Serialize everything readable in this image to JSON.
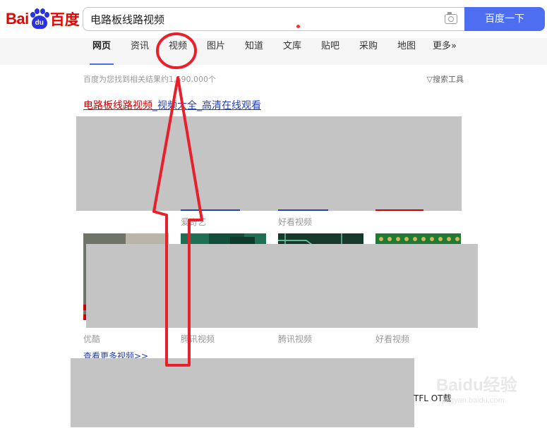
{
  "logo": {
    "bai": "Bai",
    "du": "du",
    "cn": "百度"
  },
  "search": {
    "query": "电路板线路视频",
    "button_label": "百度一下"
  },
  "tabs": [
    {
      "label": "网页",
      "active": true
    },
    {
      "label": "资讯"
    },
    {
      "label": "视频"
    },
    {
      "label": "图片"
    },
    {
      "label": "知道"
    },
    {
      "label": "文库"
    },
    {
      "label": "贴吧"
    },
    {
      "label": "采购"
    },
    {
      "label": "地图"
    },
    {
      "label": "更多»"
    }
  ],
  "results": {
    "count_text": "百度为您找到相关结果约1,690,000个",
    "tools_label": "搜索工具",
    "title_part1": "电路板线路视频",
    "title_sep": "_",
    "title_part2": "视频大全_高清在线观看",
    "row1_sources": [
      "爱奇艺",
      "好看视频"
    ],
    "row2_sources": [
      "优酷",
      "腾讯视频",
      "腾讯视频",
      "好看视频"
    ],
    "more_videos": "查看更多视频>>",
    "partial_download": "TFL OT载"
  },
  "watermark": {
    "main": "Baidu经验",
    "sub": "jingyan.baidu.com"
  },
  "annotation": {
    "color": "#e8202a"
  }
}
